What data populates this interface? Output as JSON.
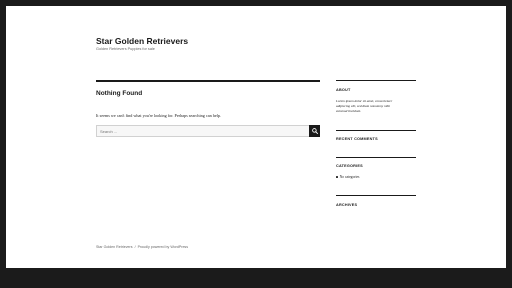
{
  "site": {
    "title": "Star Golden Retrievers",
    "description": "Golden Retrievers Puppies for sale"
  },
  "content": {
    "title": "Nothing Found",
    "message": "It seems we can't find what you're looking for. Perhaps searching can help.",
    "search": {
      "placeholder": "Search ..."
    }
  },
  "sidebar": {
    "about": {
      "title": "ABOUT",
      "lines": [
        "Lorem ipsum dolor sit amet, consectetuer",
        "adipiscing elit, sed diam nonummy nibh",
        "euismod tincidunt."
      ]
    },
    "recent_comments": {
      "title": "RECENT COMMENTS"
    },
    "categories": {
      "title": "CATEGORIES",
      "items": [
        "No categories"
      ]
    },
    "archives": {
      "title": "ARCHIVES"
    }
  },
  "footer": {
    "site_link": "Star Golden Retrievers",
    "separator": "/",
    "powered_by": "Proudly powered by WordPress"
  }
}
